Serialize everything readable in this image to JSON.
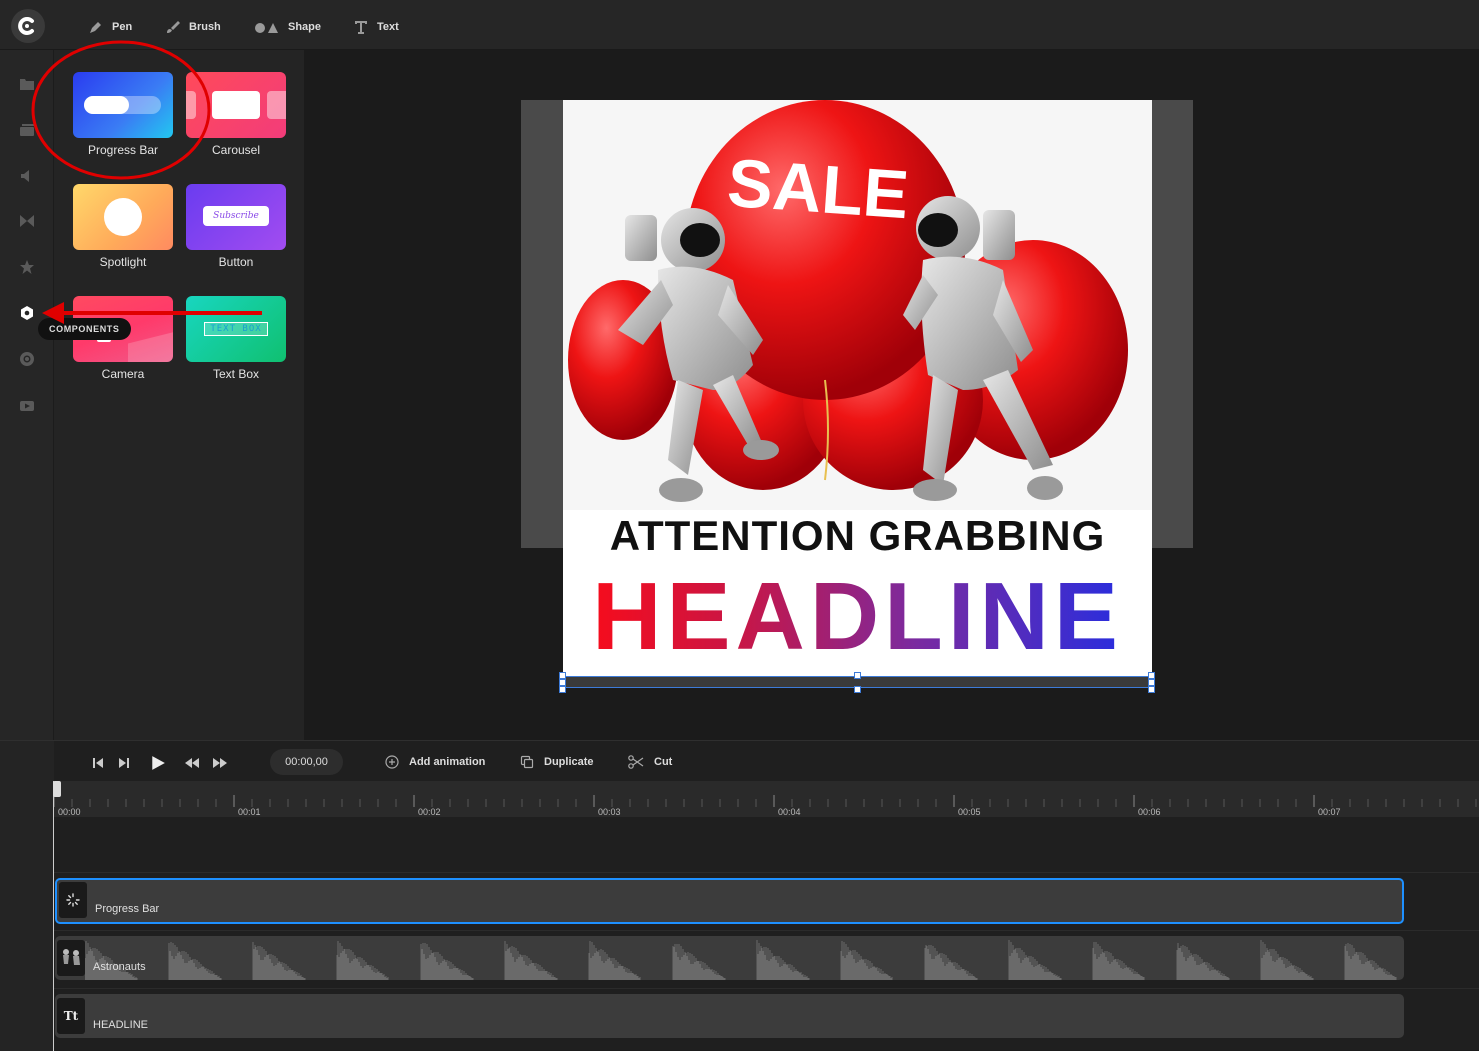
{
  "toolbar": {
    "tools": [
      {
        "label": "Pen",
        "icon": "pen-icon"
      },
      {
        "label": "Brush",
        "icon": "brush-icon"
      },
      {
        "label": "Shape",
        "icon": "shape-icon"
      },
      {
        "label": "Text",
        "icon": "text-icon"
      }
    ]
  },
  "rail": {
    "tooltip": "COMPONENTS",
    "icons": [
      "folder-icon",
      "layers-icon",
      "audio-icon",
      "transition-icon",
      "star-icon",
      "components-icon",
      "record-icon",
      "video-icon"
    ]
  },
  "components": [
    {
      "label": "Progress Bar"
    },
    {
      "label": "Carousel"
    },
    {
      "label": "Spotlight"
    },
    {
      "label": "Button",
      "thumb_text": "Subscribe"
    },
    {
      "label": "Camera"
    },
    {
      "label": "Text Box",
      "thumb_text": "TEXT BOX"
    }
  ],
  "artboard": {
    "balloon_text": "SALE",
    "headline_line1": "ATTENTION GRABBING",
    "headline_line2": "HEADLINE"
  },
  "timeline": {
    "timecode": "00:00,00",
    "actions": [
      {
        "label": "Add animation",
        "icon": "add-circle-icon"
      },
      {
        "label": "Duplicate",
        "icon": "duplicate-icon"
      },
      {
        "label": "Cut",
        "icon": "scissors-icon"
      }
    ],
    "ruler_labels": [
      "00:00",
      "00:01",
      "00:02",
      "00:03",
      "00:04",
      "00:05",
      "00:06",
      "00:07"
    ],
    "tracks": [
      {
        "label": "Progress Bar",
        "selected": true
      },
      {
        "label": "Astronauts",
        "icon_text": ""
      },
      {
        "label": "HEADLINE",
        "icon_text": "Tt"
      }
    ]
  },
  "colors": {
    "accent": "#1e90ff",
    "annotation_red": "#e00000"
  }
}
